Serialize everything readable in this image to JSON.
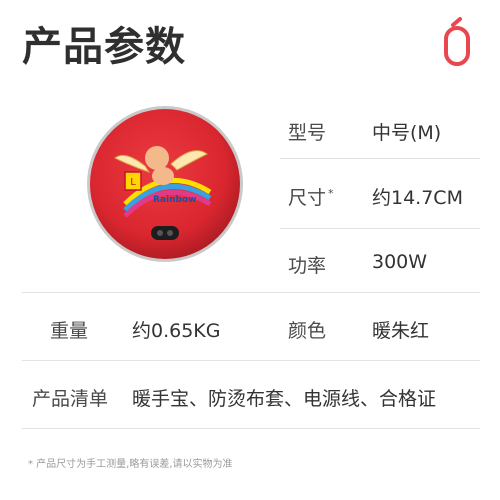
{
  "page": {
    "title": "产品参数"
  },
  "brand": {
    "accent_color": "#e8474f",
    "logo_icon": "o-ring-logo-icon"
  },
  "product_image": {
    "badge_text": "Rainbow",
    "body_color": "#d9262f"
  },
  "specs": {
    "model": {
      "label": "型号",
      "value": "中号(M)"
    },
    "size": {
      "label": "尺寸",
      "marker": "*",
      "value": "约14.7CM"
    },
    "power": {
      "label": "功率",
      "value": "300W"
    },
    "weight": {
      "label": "重量",
      "value": "约0.65KG"
    },
    "color": {
      "label": "颜色",
      "value": "暖朱红"
    },
    "contents": {
      "label": "产品清单",
      "value": "暖手宝、防烫布套、电源线、合格证"
    }
  },
  "footnote": "* 产品尺寸为手工测量,略有误差,请以实物为准"
}
